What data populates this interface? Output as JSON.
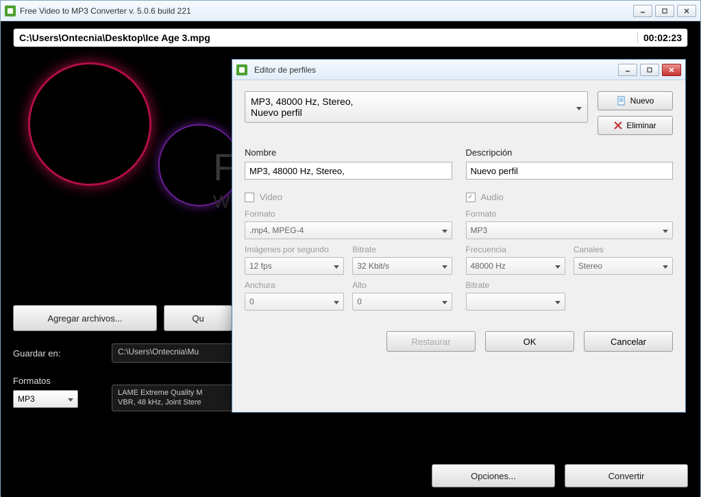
{
  "main": {
    "title": "Free Video to MP3 Converter  v. 5.0.6 build 221",
    "file_path": "C:\\Users\\Ontecnia\\Desktop\\Ice Age 3.mpg",
    "duration": "00:02:23",
    "bg_text1": "FR",
    "bg_text2": "WV",
    "add_files": "Agregar archivos...",
    "remove": "Qu",
    "save_label": "Guardar en:",
    "save_path": "C:\\Users\\Ontecnia\\Mu",
    "formats_label": "Formatos",
    "format_value": "MP3",
    "encoder_text": "LAME Extreme Quality M\nVBR, 48 kHz, Joint Stere",
    "options": "Opciones...",
    "convert": "Convertir"
  },
  "dialog": {
    "title": "Editor de perfiles",
    "profile_line1": "MP3, 48000 Hz, Stereo,",
    "profile_line2": "Nuevo perfil",
    "new_btn": "Nuevo",
    "delete_btn": "Eliminar",
    "name_label": "Nombre",
    "name_value": "MP3, 48000 Hz, Stereo,",
    "desc_label": "Descripción",
    "desc_value": "Nuevo perfil",
    "video": {
      "checkbox_label": "Video",
      "format_label": "Formato",
      "format_value": ".mp4, MPEG-4",
      "fps_label": "Imágenes por segundo",
      "fps_value": "12 fps",
      "bitrate_label": "Bitrate",
      "bitrate_value": "32 Kbit/s",
      "width_label": "Anchura",
      "width_value": "0",
      "height_label": "Alto",
      "height_value": "0"
    },
    "audio": {
      "checkbox_label": "Audio",
      "format_label": "Formato",
      "format_value": "MP3",
      "freq_label": "Frecuencia",
      "freq_value": "48000 Hz",
      "channels_label": "Canales",
      "channels_value": "Stereo",
      "bitrate_label": "Bitrate",
      "bitrate_value": ""
    },
    "restore": "Restaurar",
    "ok": "OK",
    "cancel": "Cancelar"
  }
}
